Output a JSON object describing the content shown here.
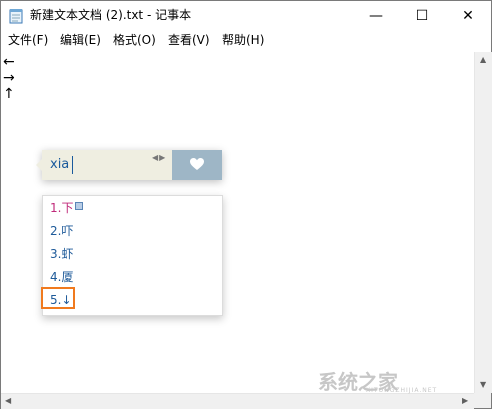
{
  "window": {
    "title": "新建文本文档 (2).txt - 记事本",
    "controls": {
      "minimize": "—",
      "maximize": "☐",
      "close": "✕"
    }
  },
  "menu": [
    {
      "label": "文件(F)"
    },
    {
      "label": "编辑(E)"
    },
    {
      "label": "格式(O)"
    },
    {
      "label": "查看(V)"
    },
    {
      "label": "帮助(H)"
    }
  ],
  "editor": {
    "lines": [
      "←",
      "→",
      "↑"
    ]
  },
  "ime": {
    "input_text": "xia",
    "nav_arrows": "◀▶",
    "candidates": [
      {
        "label": "1.下"
      },
      {
        "label": "2.吓"
      },
      {
        "label": "3.虾"
      },
      {
        "label": "4.厦"
      },
      {
        "label": "5.↓"
      }
    ]
  },
  "scrollbar": {
    "up": "▲",
    "down": "▼",
    "left": "◀",
    "right": "▶"
  },
  "watermark": {
    "text": "系统之家",
    "sub": "XITONGZHIJIA.NET"
  },
  "colors": {
    "ime_input_bg": "#efeee1",
    "ime_action_bg": "#9eb6c6",
    "candidate_text": "#1e5a99",
    "first_candidate": "#c02a7a",
    "highlight": "#f07a1e"
  }
}
